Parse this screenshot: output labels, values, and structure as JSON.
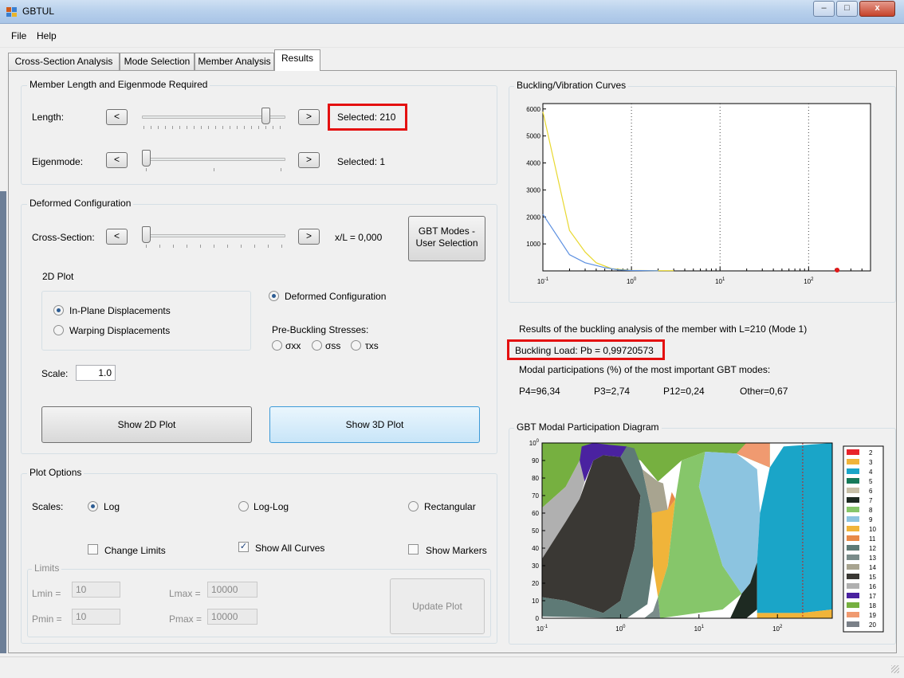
{
  "window": {
    "title": "GBTUL",
    "minimize": "–",
    "maximize": "□",
    "close": "x"
  },
  "menu": [
    "File",
    "Help"
  ],
  "tabs": [
    {
      "label": "Cross-Section Analysis"
    },
    {
      "label": "Mode Selection"
    },
    {
      "label": "Member Analysis"
    },
    {
      "label": "Results"
    }
  ],
  "active_tab": "Results",
  "member_group": {
    "title": "Member Length and Eigenmode Required",
    "length_label": "Length:",
    "length_selected": "Selected: 210",
    "length_slider_level": 0.88,
    "eigen_label": "Eigenmode:",
    "eigen_selected": "Selected: 1",
    "eigen_slider_level": 0.0,
    "prev": "<",
    "next": ">"
  },
  "deformed_group": {
    "title": "Deformed Configuration",
    "cross_section_label": "Cross-Section:",
    "xl_text": "x/L =  0,000",
    "gbt_button": "GBT Modes -\nUser Selection",
    "plot2d_title": "2D Plot",
    "inplane": "In-Plane Displacements",
    "warping": "Warping Displacements",
    "deformed_configuration": "Deformed Configuration",
    "prebuckling": "Pre-Buckling Stresses:",
    "stress_xx": "σxx",
    "stress_ss": "σss",
    "stress_xs": "τxs",
    "scale_label": "Scale:",
    "scale_value": "1.0",
    "show2d": "Show 2D Plot",
    "show3d": "Show 3D Plot"
  },
  "plot_options": {
    "title": "Plot Options",
    "scales_label": "Scales:",
    "log": "Log",
    "loglog": "Log-Log",
    "rectangular": "Rectangular",
    "change_limits": "Change Limits",
    "show_all_curves": "Show All Curves",
    "show_markers": "Show Markers",
    "limits_title": "Limits",
    "lmin_label": "Lmin =",
    "lmin": "10",
    "lmax_label": "Lmax =",
    "lmax": "10000",
    "pmin_label": "Pmin =",
    "pmin": "10",
    "pmax_label": "Pmax =",
    "pmax": "10000",
    "update_plot": "Update Plot"
  },
  "results": {
    "curves_title": "Buckling/Vibration Curves",
    "summary": "Results of the buckling analysis of the member with L=210 (Mode 1)",
    "buckling_load": "Buckling Load: Pb = 0,99720573",
    "modal_caption": "Modal participations (%) of the most important GBT modes:",
    "participations": [
      "P4=96,34",
      "P3=2,74",
      "P12=0,24",
      "Other=0,67"
    ],
    "diagram_title": "GBT Modal Participation Diagram"
  },
  "chart_data": [
    {
      "type": "line",
      "title": "Buckling/Vibration Curves",
      "xscale": "log",
      "xlim": [
        0.1,
        500
      ],
      "ylim": [
        0,
        6200
      ],
      "yticks": [
        "1000",
        "2000",
        "3000",
        "4000",
        "5000",
        "6000"
      ],
      "xticks": [
        "10-1",
        "100",
        "101",
        "102"
      ],
      "series": [
        {
          "color": "#e8d830",
          "x": [
            0.1,
            0.2,
            0.3,
            0.4,
            0.6,
            1.0,
            2.0,
            3.0
          ],
          "y": [
            5900,
            1500,
            700,
            300,
            80,
            20,
            10,
            8
          ]
        },
        {
          "color": "#5b8fe0",
          "x": [
            0.1,
            0.2,
            0.3,
            0.5,
            0.7,
            1.0,
            2.0
          ],
          "y": [
            2100,
            600,
            300,
            120,
            40,
            15,
            5
          ]
        }
      ],
      "marker": {
        "x": 210,
        "y": 1,
        "color": "#e01818"
      }
    },
    {
      "type": "area",
      "title": "GBT Modal Participation Diagram",
      "xscale": "log",
      "ylim": [
        0,
        100
      ],
      "yticks": [
        "0",
        "10",
        "20",
        "30",
        "40",
        "50",
        "60",
        "70",
        "80",
        "90",
        "100"
      ],
      "xticks": [
        "10-1",
        "100",
        "101",
        "102"
      ],
      "legend": [
        "2",
        "3",
        "4",
        "5",
        "6",
        "7",
        "8",
        "9",
        "10",
        "11",
        "12",
        "13",
        "14",
        "15",
        "16",
        "17",
        "18",
        "19",
        "20"
      ],
      "legend_colors": [
        "#e8232b",
        "#f0b43a",
        "#1aa5c8",
        "#167a5a",
        "#c8c0a8",
        "#1e2a22",
        "#86c66a",
        "#8cc4e0",
        "#f0b43a",
        "#e88a48",
        "#5e7a76",
        "#7a8c8a",
        "#a8a490",
        "#3a3834",
        "#b0b0b0",
        "#4a22a0",
        "#76b040",
        "#f09a70",
        "#7a8088"
      ],
      "legend_position": "right"
    }
  ]
}
